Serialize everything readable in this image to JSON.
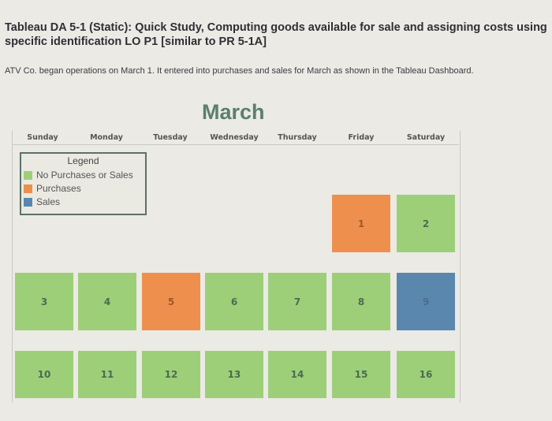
{
  "title": "Tableau DA 5-1 (Static): Quick Study, Computing goods available for sale and assigning costs using specific identification LO P1 [similar to PR 5-1A]",
  "intro": "ATV Co. began operations on March 1. It entered into purchases and sales for March as shown in the Tableau Dashboard.",
  "calendar": {
    "month": "March",
    "days_of_week": [
      "Sunday",
      "Monday",
      "Tuesday",
      "Wednesday",
      "Thursday",
      "Friday",
      "Saturday"
    ],
    "legend": {
      "title": "Legend",
      "items": [
        {
          "label": "No Purchases or Sales",
          "color": "#9dcf79"
        },
        {
          "label": "Purchases",
          "color": "#ef8f4e"
        },
        {
          "label": "Sales",
          "color": "#5a87ad"
        }
      ]
    },
    "colors": {
      "none": "#9dcf79",
      "purchase": "#ef8f4e",
      "sale": "#5a87ad"
    },
    "days": [
      {
        "day": "1",
        "weekday": 5,
        "week": 0,
        "type": "purchase"
      },
      {
        "day": "2",
        "weekday": 6,
        "week": 0,
        "type": "none"
      },
      {
        "day": "3",
        "weekday": 0,
        "week": 1,
        "type": "none"
      },
      {
        "day": "4",
        "weekday": 1,
        "week": 1,
        "type": "none"
      },
      {
        "day": "5",
        "weekday": 2,
        "week": 1,
        "type": "purchase"
      },
      {
        "day": "6",
        "weekday": 3,
        "week": 1,
        "type": "none"
      },
      {
        "day": "7",
        "weekday": 4,
        "week": 1,
        "type": "none"
      },
      {
        "day": "8",
        "weekday": 5,
        "week": 1,
        "type": "none"
      },
      {
        "day": "9",
        "weekday": 6,
        "week": 1,
        "type": "sale"
      },
      {
        "day": "10",
        "weekday": 0,
        "week": 2,
        "type": "none"
      },
      {
        "day": "11",
        "weekday": 1,
        "week": 2,
        "type": "none"
      },
      {
        "day": "12",
        "weekday": 2,
        "week": 2,
        "type": "none"
      },
      {
        "day": "13",
        "weekday": 3,
        "week": 2,
        "type": "none"
      },
      {
        "day": "14",
        "weekday": 4,
        "week": 2,
        "type": "none"
      },
      {
        "day": "15",
        "weekday": 5,
        "week": 2,
        "type": "none"
      },
      {
        "day": "16",
        "weekday": 6,
        "week": 2,
        "type": "none"
      }
    ]
  }
}
